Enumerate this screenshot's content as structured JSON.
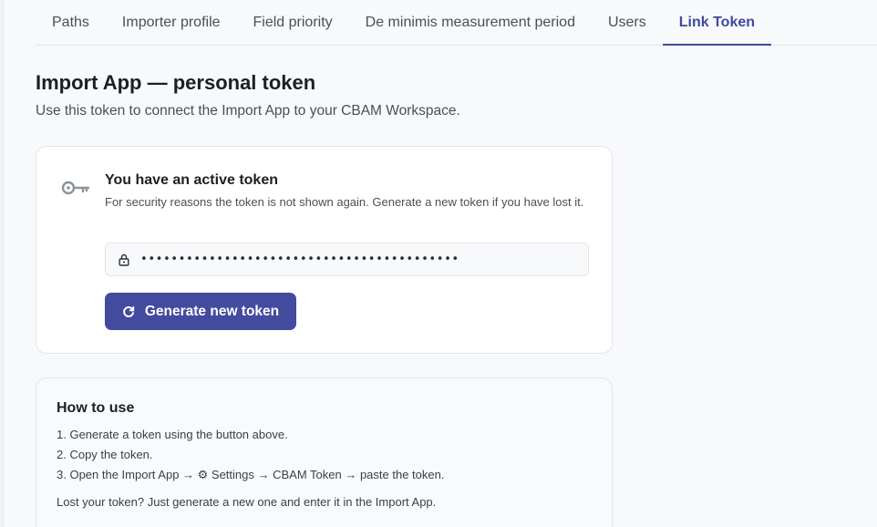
{
  "tabs": [
    {
      "label": "Paths"
    },
    {
      "label": "Importer profile"
    },
    {
      "label": "Field priority"
    },
    {
      "label": "De minimis measurement period"
    },
    {
      "label": "Users"
    },
    {
      "label": "Link Token"
    }
  ],
  "active_tab": "Link Token",
  "header": {
    "title": "Import App — personal token",
    "subtitle": "Use this token to connect the Import App to your CBAM Workspace."
  },
  "token_card": {
    "icon": "key-icon",
    "heading": "You have an active token",
    "description": "For security reasons the token is not shown again. Generate a new token if you have lost it.",
    "token_mask": "••••••••••••••••••••••••••••••••••••••••••",
    "field_icon": "lock-icon",
    "button_label": "Generate new token",
    "button_icon": "refresh-icon"
  },
  "help_card": {
    "heading": "How to use",
    "steps": [
      "1. Generate a token using the button above.",
      "2. Copy the token.",
      "3. Open the Import App → ⚙ Settings → CBAM Token → paste the token."
    ],
    "note": "Lost your token? Just generate a new one and enter it in the Import App."
  },
  "colors": {
    "accent": "#434b9e",
    "active_tab": "#414a9e",
    "background": "#f8f9fb"
  }
}
